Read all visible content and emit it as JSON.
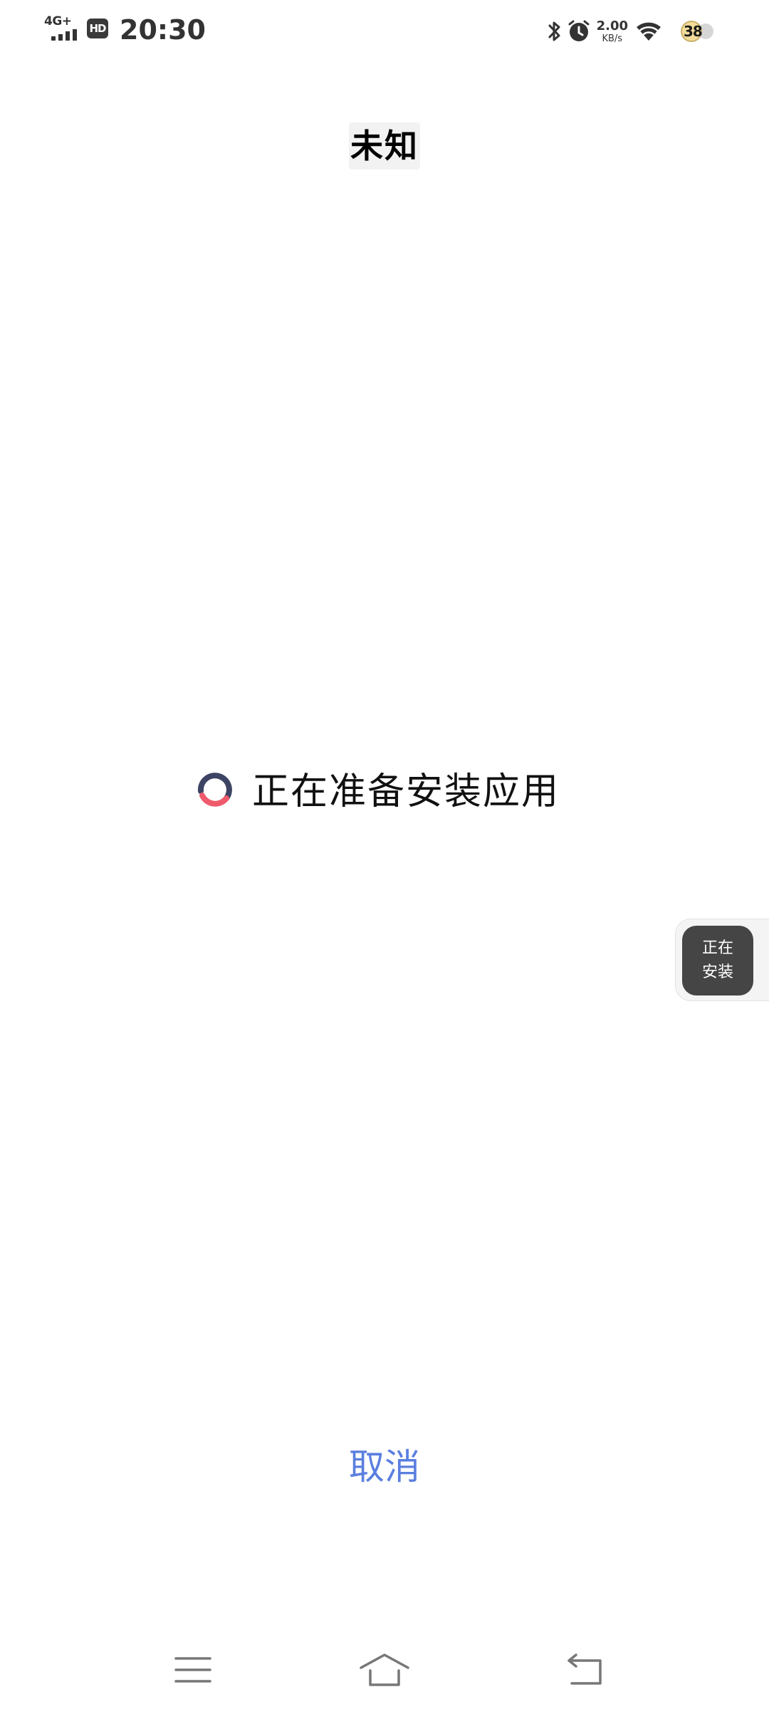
{
  "status_bar": {
    "network_type": "4G+",
    "hd_badge": "HD",
    "time": "20:30",
    "net_speed_value": "2.00",
    "net_speed_unit": "KB/s",
    "battery_level": "38",
    "icons": [
      "signal-icon",
      "bluetooth-icon",
      "alarm-icon",
      "wifi-icon",
      "battery-icon"
    ]
  },
  "header": {
    "app_name": "未知"
  },
  "progress": {
    "message": "正在准备安装应用",
    "spinner_colors": [
      "#3d4463",
      "#ef5a6c"
    ]
  },
  "floating_indicator": {
    "line1": "正在",
    "line2": "安装"
  },
  "actions": {
    "cancel_label": "取消",
    "cancel_color": "#5b7fe0"
  },
  "nav_bar": {
    "buttons": [
      "menu-icon",
      "home-icon",
      "back-icon"
    ]
  }
}
